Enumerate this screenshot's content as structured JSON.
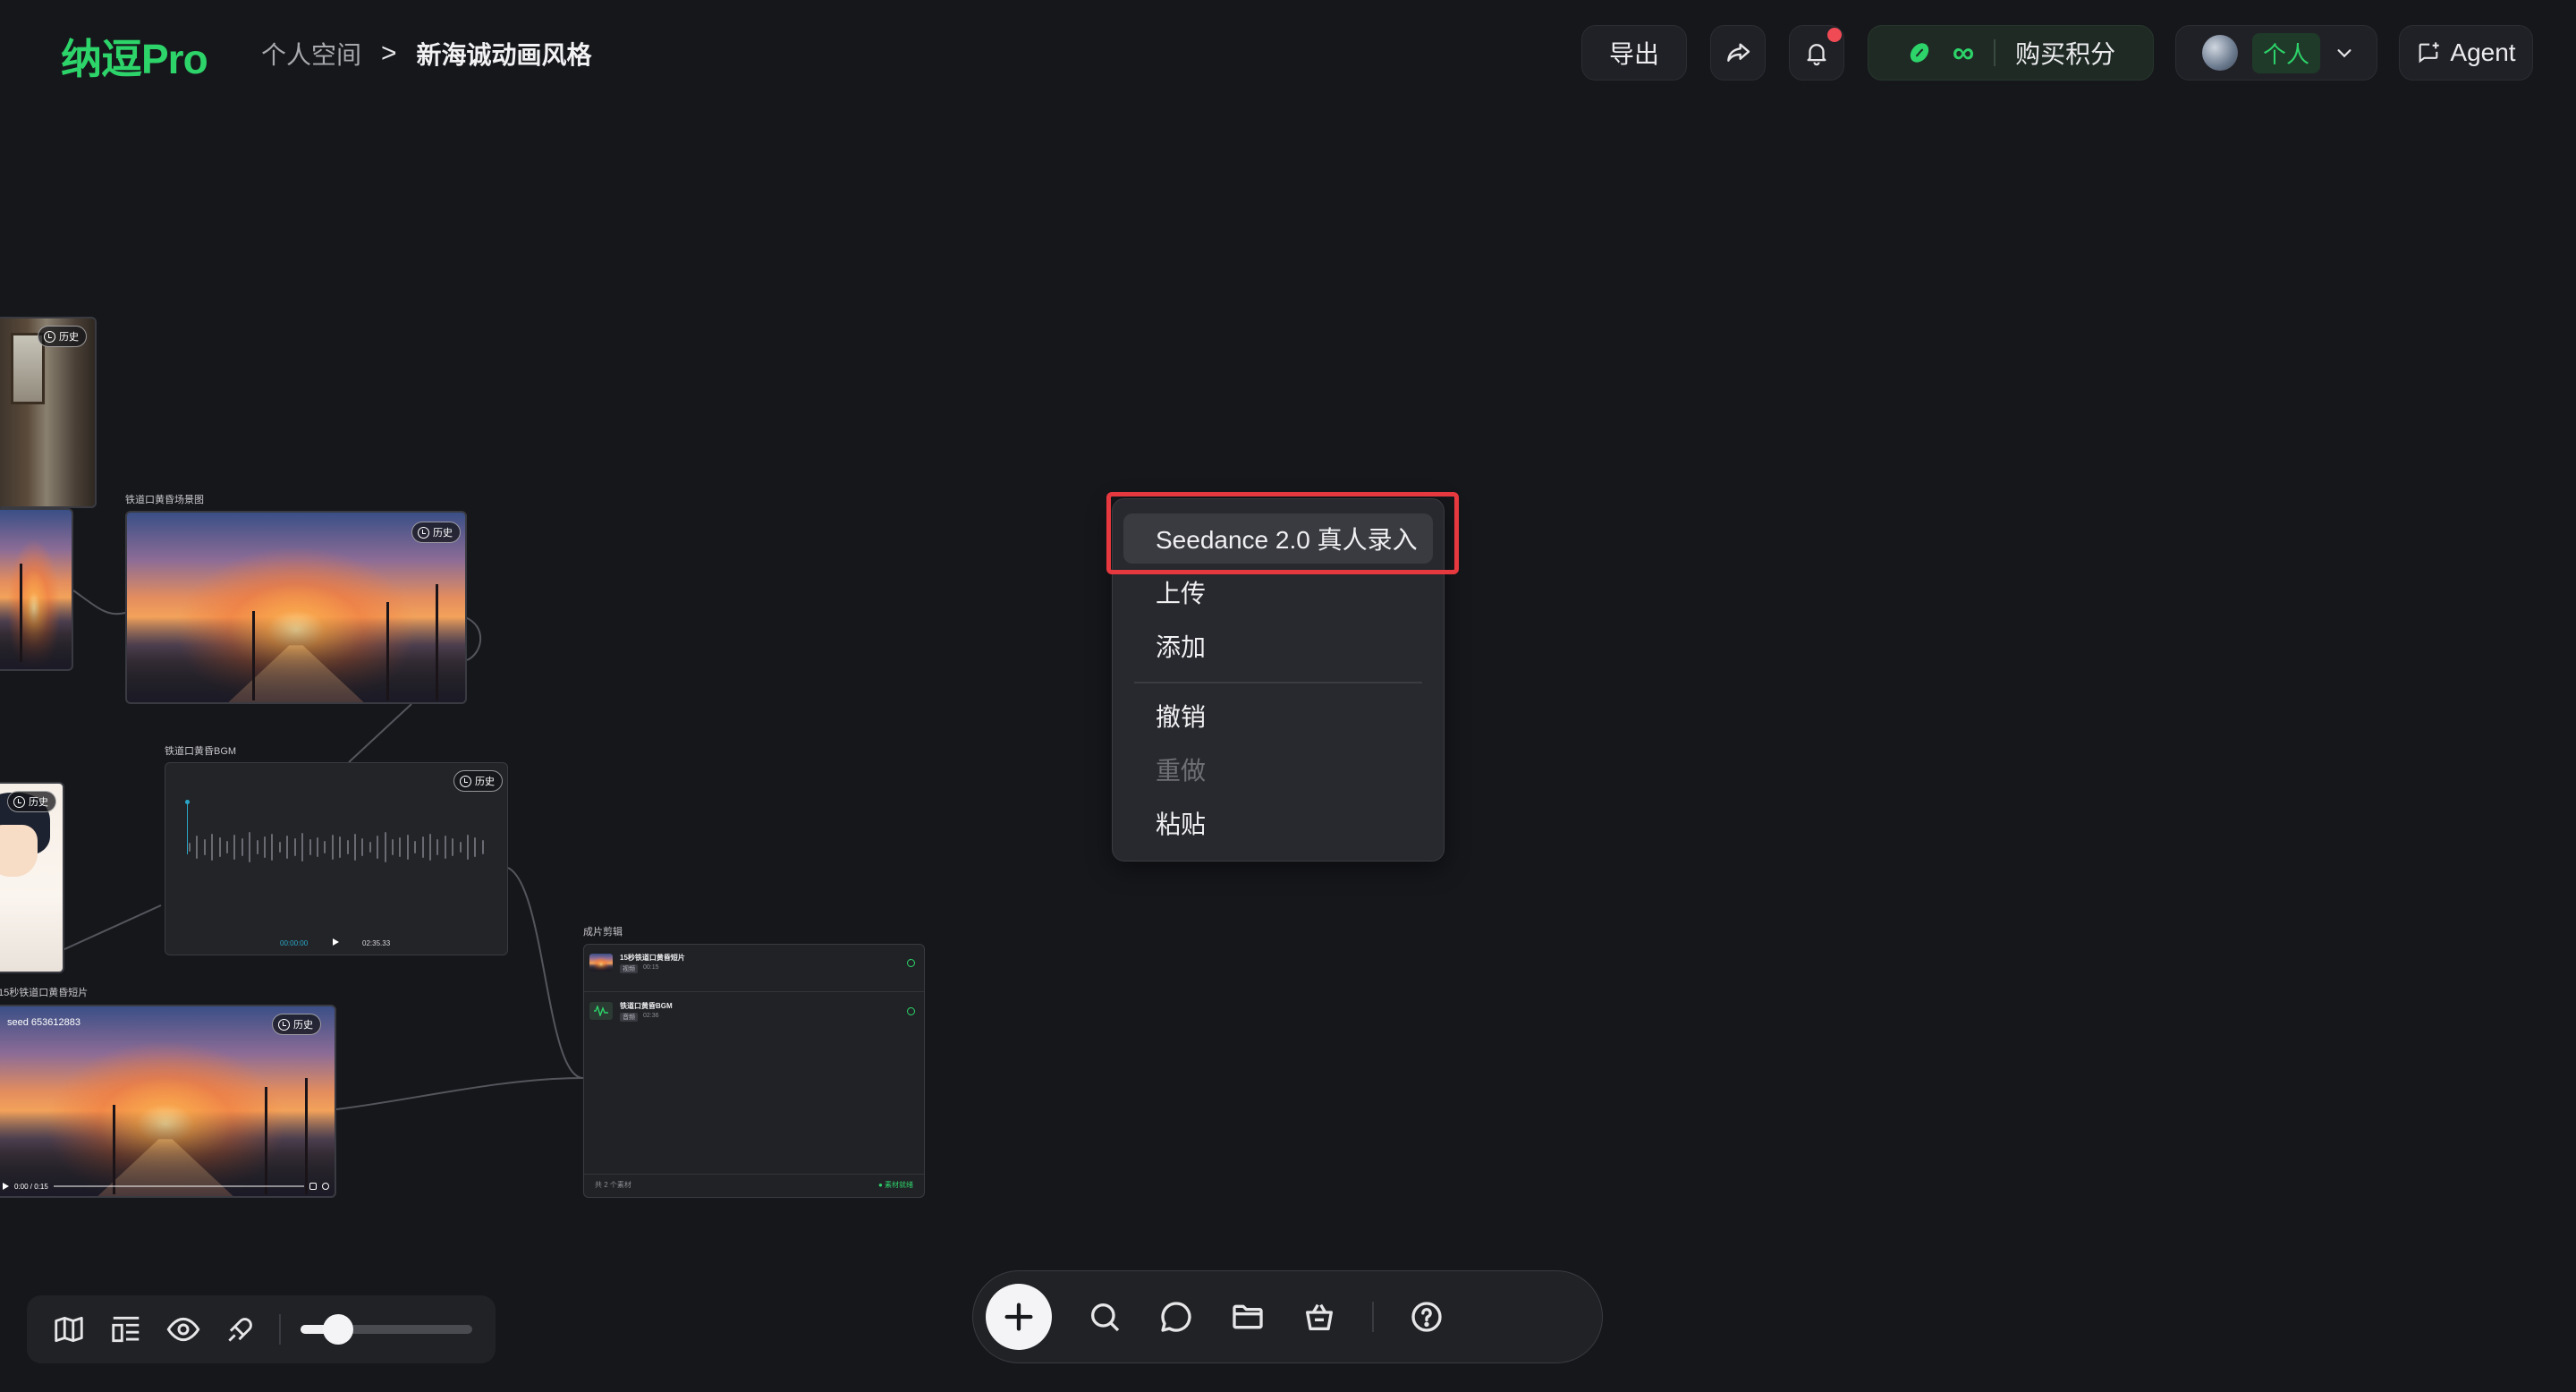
{
  "app": {
    "logo": "纳逗Pro"
  },
  "breadcrumb": {
    "root": "个人空间",
    "separator": ">",
    "current": "新海诚动画风格"
  },
  "header": {
    "export_label": "导出",
    "share_icon": "share-icon",
    "bell_icon": "bell-icon",
    "credits_icon": "bean-icon",
    "credits_value": "∞",
    "buy_credits_label": "购买积分",
    "account_badge": "个人",
    "agent_label": "Agent"
  },
  "colors": {
    "accent": "#2dd46a",
    "highlight": "#e6393f",
    "background": "#16171b"
  },
  "nodes": {
    "history_label": "历史",
    "image1": {
      "title": "铁道口黄昏场景图"
    },
    "audio": {
      "title": "铁道口黄昏BGM",
      "time_current": "00:00:00",
      "time_total": "02:35.33"
    },
    "video": {
      "title": "15秒铁道口黄昏短片",
      "seed": "seed 653612883",
      "time": "0:00 / 0:15"
    },
    "edit": {
      "title": "成片剪辑",
      "items": [
        {
          "name": "15秒铁道口黄昏短片",
          "tag": "视频",
          "duration": "00:15"
        },
        {
          "name": "铁道口黄昏BGM",
          "tag": "音频",
          "duration": "02:36"
        }
      ],
      "footer_count": "共 2 个素材",
      "footer_status": "● 素材就绪"
    }
  },
  "context_menu": {
    "items": [
      {
        "label": "Seedance 2.0 真人录入",
        "highlighted": true,
        "disabled": false
      },
      {
        "label": "上传",
        "highlighted": false,
        "disabled": false
      },
      {
        "label": "添加",
        "highlighted": false,
        "disabled": false
      },
      {
        "label": "撤销",
        "highlighted": false,
        "disabled": false
      },
      {
        "label": "重做",
        "highlighted": false,
        "disabled": true
      },
      {
        "label": "粘贴",
        "highlighted": false,
        "disabled": false
      }
    ]
  },
  "toolbar_left": {
    "icons": [
      "map-icon",
      "layout-icon",
      "eye-icon",
      "magnet-icon"
    ],
    "zoom_level": 0.22
  },
  "toolbar_center": {
    "icons": [
      "plus-icon",
      "search-icon",
      "chat-icon",
      "folder-icon",
      "basket-icon",
      "help-icon"
    ]
  }
}
